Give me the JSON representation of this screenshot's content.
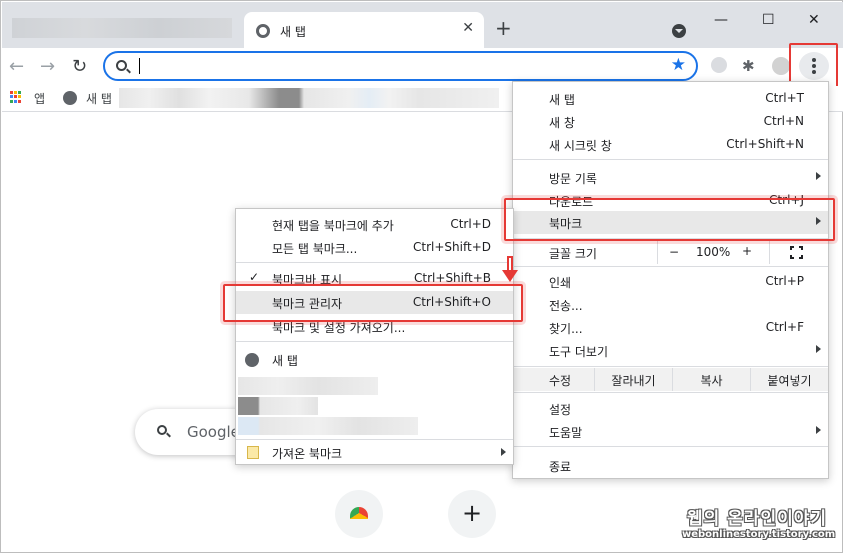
{
  "tab": {
    "title": "새 탭",
    "close": "✕"
  },
  "tabstrip": {
    "new_tab": "+",
    "window_min": "—",
    "window_max": "☐",
    "window_close": "✕"
  },
  "toolbar": {
    "back": "←",
    "forward": "→",
    "reload": "↻",
    "omnibox_value": "",
    "star": "★",
    "extensions": "✱"
  },
  "bookmarks_bar": {
    "apps_label": "앱",
    "new_tab_label": "새 탭"
  },
  "new_tab_page": {
    "search_text": "Google"
  },
  "main_menu": {
    "items": [
      {
        "label": "새 탭",
        "shortcut": "Ctrl+T"
      },
      {
        "label": "새 창",
        "shortcut": "Ctrl+N"
      },
      {
        "label": "새 시크릿 창",
        "shortcut": "Ctrl+Shift+N"
      },
      {
        "label": "방문 기록",
        "shortcut": ""
      },
      {
        "label": "다운로드",
        "shortcut": "Ctrl+J"
      },
      {
        "label": "북마크",
        "shortcut": ""
      },
      {
        "label": "글꼴 크기",
        "shortcut": ""
      },
      {
        "label": "인쇄",
        "shortcut": "Ctrl+P"
      },
      {
        "label": "전송...",
        "shortcut": ""
      },
      {
        "label": "찾기...",
        "shortcut": "Ctrl+F"
      },
      {
        "label": "도구 더보기",
        "shortcut": ""
      },
      {
        "label": "설정",
        "shortcut": ""
      },
      {
        "label": "도움말",
        "shortcut": ""
      },
      {
        "label": "종료",
        "shortcut": ""
      }
    ],
    "zoom": {
      "minus": "−",
      "value": "100%",
      "plus": "+"
    },
    "edit": {
      "label": "수정",
      "cut": "잘라내기",
      "copy": "복사",
      "paste": "붙여넣기"
    }
  },
  "bookmark_submenu": {
    "items": [
      {
        "label": "현재 탭을 북마크에 추가",
        "shortcut": "Ctrl+D"
      },
      {
        "label": "모든 탭 북마크...",
        "shortcut": "Ctrl+Shift+D"
      },
      {
        "label": "북마크바 표시",
        "shortcut": "Ctrl+Shift+B"
      },
      {
        "label": "북마크 관리자",
        "shortcut": "Ctrl+Shift+O"
      },
      {
        "label": "북마크 및 설정 가져오기...",
        "shortcut": ""
      },
      {
        "label": "새 탭",
        "shortcut": ""
      },
      {
        "label": "가져온 북마크",
        "shortcut": ""
      }
    ],
    "check_mark": "✓"
  },
  "watermark": {
    "line1": "웹의 온라인이야기",
    "line2": "webonlinestory.tistory.com"
  },
  "colors": {
    "accent": "#1a73e8",
    "highlight_red": "#e53935",
    "menu_hover": "#e8e8e8"
  }
}
